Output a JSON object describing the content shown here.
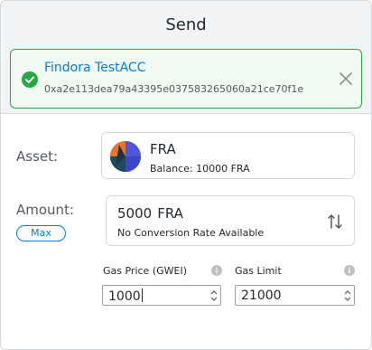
{
  "header": {
    "title": "Send"
  },
  "account": {
    "name": "Findora TestACC",
    "address": "0xa2e113dea79a43395e037583265060a21ce70f1e"
  },
  "asset": {
    "label": "Asset:",
    "symbol": "FRA",
    "balance": "Balance: 10000 FRA"
  },
  "amount": {
    "label": "Amount:",
    "max_label": "Max",
    "value": "5000",
    "unit": "FRA",
    "conversion": "No Conversion Rate Available"
  },
  "gas": {
    "price_label": "Gas Price (GWEI)",
    "price_value": "1000",
    "limit_label": "Gas Limit",
    "limit_value": "21000"
  },
  "colors": {
    "accent": "#037dd6",
    "success": "#28a745",
    "header_bg": "#f2f3f4"
  }
}
